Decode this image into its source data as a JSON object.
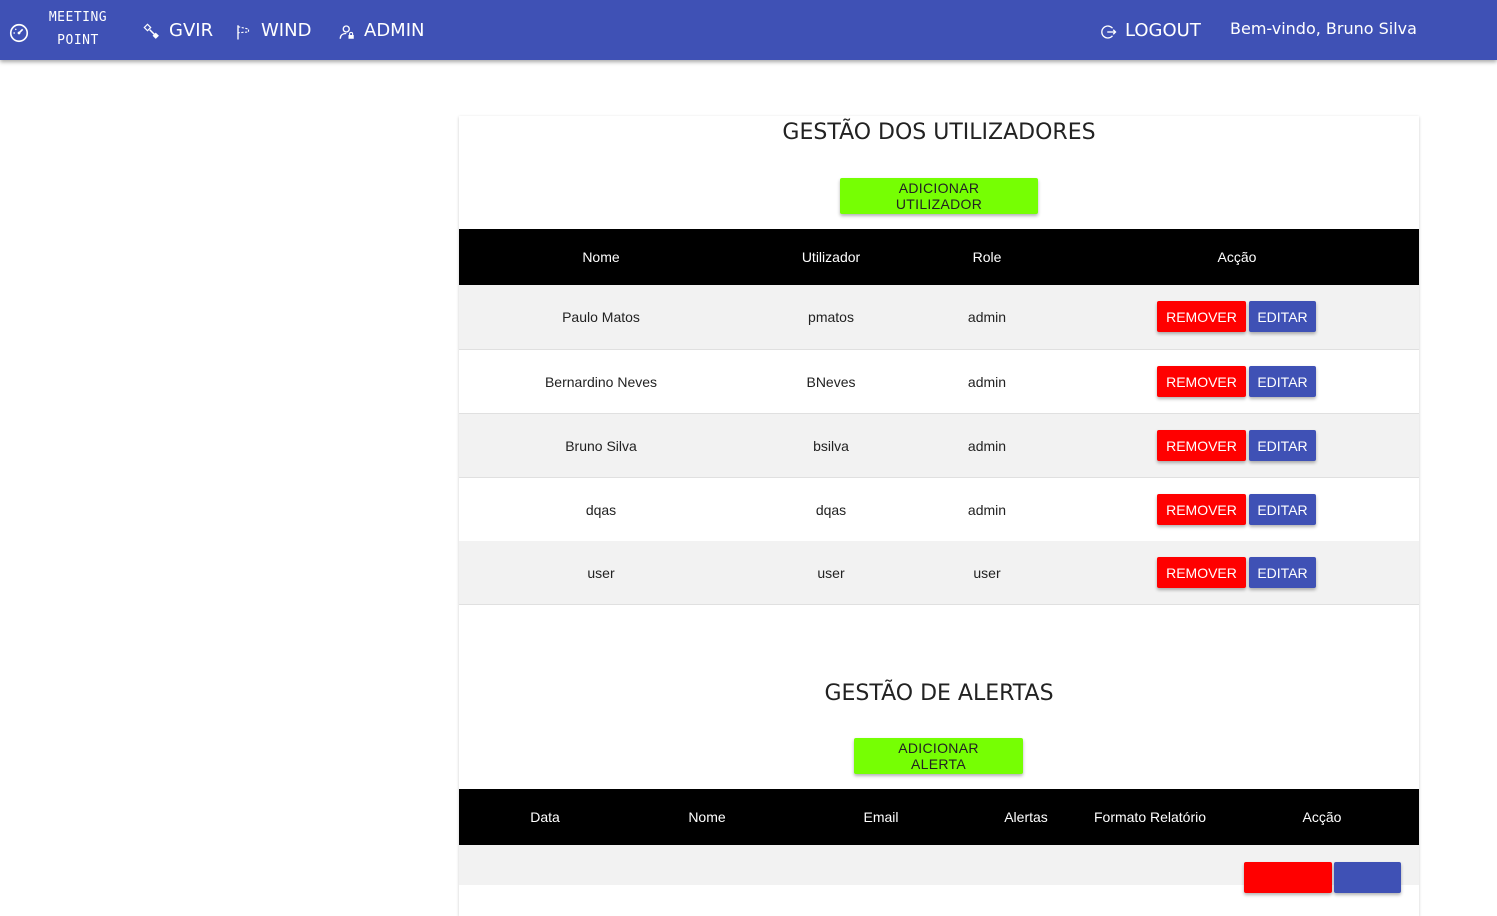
{
  "navbar": {
    "brand_line1": "MEETING",
    "brand_line2": "POINT",
    "items": [
      {
        "label": "GVIR",
        "icon": "satellite-icon"
      },
      {
        "label": "WIND",
        "icon": "windsock-icon"
      },
      {
        "label": "ADMIN",
        "icon": "admin-user-icon"
      }
    ],
    "logout_label": "LOGOUT",
    "welcome": "Bem-vindo, Bruno Silva",
    "color": "#3f51b5"
  },
  "users": {
    "title": "GESTÃO DOS UTILIZADORES",
    "add_label": "ADICIONAR UTILIZADOR",
    "columns": [
      "Nome",
      "Utilizador",
      "Role",
      "Acção"
    ],
    "rows": [
      {
        "nome": "Paulo Matos",
        "utilizador": "pmatos",
        "role": "admin"
      },
      {
        "nome": "Bernardino Neves",
        "utilizador": "BNeves",
        "role": "admin"
      },
      {
        "nome": "Bruno Silva",
        "utilizador": "bsilva",
        "role": "admin"
      },
      {
        "nome": "dqas",
        "utilizador": "dqas",
        "role": "admin"
      },
      {
        "nome": "user",
        "utilizador": "user",
        "role": "user"
      }
    ],
    "remove_label": "REMOVER",
    "edit_label": "EDITAR"
  },
  "alerts": {
    "title": "GESTÃO DE ALERTAS",
    "add_label": "ADICIONAR ALERTA",
    "columns": [
      "Data",
      "Nome",
      "Email",
      "Alertas",
      "Formato Relatório",
      "Acção"
    ]
  },
  "colors": {
    "add_button": "#76ff03",
    "remove_button": "#ff0000",
    "edit_button": "#3f51b5",
    "table_header": "#000000"
  }
}
